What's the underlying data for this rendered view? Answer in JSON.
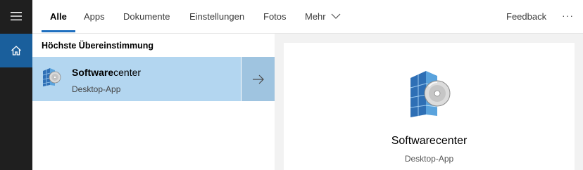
{
  "nav": {
    "tabs": [
      {
        "label": "Alle"
      },
      {
        "label": "Apps"
      },
      {
        "label": "Dokumente"
      },
      {
        "label": "Einstellungen"
      },
      {
        "label": "Fotos"
      },
      {
        "label": "Mehr"
      }
    ],
    "active_tab": "Alle",
    "feedback_label": "Feedback",
    "more_options": "···"
  },
  "results": {
    "heading": "Höchste Übereinstimmung",
    "best_match": {
      "name_highlight": "Software",
      "name_rest": "center",
      "type": "Desktop-App",
      "icon": "software-center-icon"
    }
  },
  "preview": {
    "name": "Softwarecenter",
    "type": "Desktop-App",
    "icon": "software-center-icon"
  },
  "colors": {
    "rail_bg": "#1f1f1f",
    "home_selected": "#1a5f9c",
    "accent": "#1f6fbf",
    "selected_row": "#b3d6f0",
    "arrow_bg": "#9fc4e0"
  }
}
